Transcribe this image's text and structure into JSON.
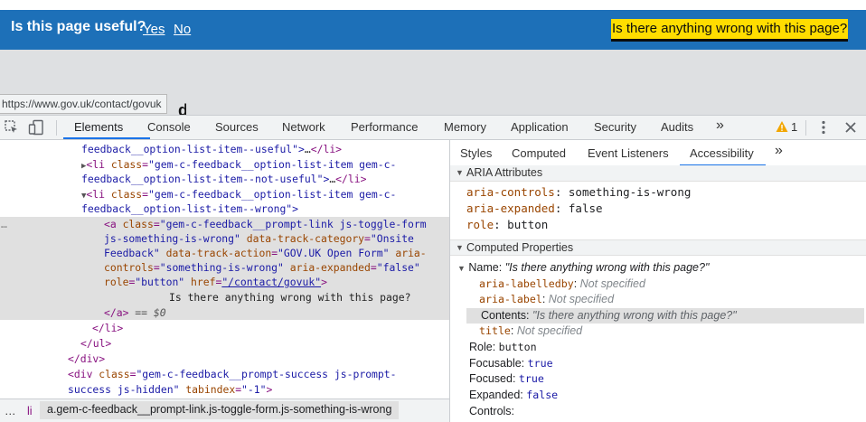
{
  "page": {
    "feedback_question": "Is this page useful?",
    "yes": "Yes",
    "no": "No",
    "wrong_link": "Is there anything wrong with this page?",
    "url_tooltip": "https://www.gov.uk/contact/govuk"
  },
  "devtools": {
    "tabs": [
      "Elements",
      "Console",
      "Sources",
      "Network",
      "Performance",
      "Memory",
      "Application",
      "Security",
      "Audits"
    ],
    "more_tabs": "»",
    "warning_count": "1",
    "code": {
      "l0_text": "feedback__option-list-item--useful\">",
      "l0_ell": "…",
      "l0_close": "</li>",
      "l1_open": "<li",
      "l1_attr": "class",
      "l1_val": "\"gem-c-feedback__option-list-item gem-c-",
      "l2_val": "feedback__option-list-item--not-useful\">",
      "l2_ell": "…",
      "l2_close": "</li>",
      "l3_open": "<li",
      "l3_attr": "class",
      "l3_val": "\"gem-c-feedback__option-list-item gem-c-",
      "l4_val": "feedback__option-list-item--wrong\">",
      "l5_dots": "…",
      "l5_open": "<a",
      "l5_attr": "class",
      "l5_val": "\"gem-c-feedback__prompt-link js-toggle-form",
      "l6_val": "js-something-is-wrong\"",
      "l6_attr": "data-track-category",
      "l6_val2": "\"Onsite",
      "l7_val": "Feedback\"",
      "l7_attr": "data-track-action",
      "l7_val2": "\"GOV.UK Open Form\"",
      "l7_attr2": "aria-",
      "l8_attr": "controls",
      "l8_val": "\"something-is-wrong\"",
      "l8_attr2": "aria-expanded",
      "l8_val2": "\"false\"",
      "l9_attr": "role",
      "l9_val": "\"button\"",
      "l9_attr2": "href",
      "l9_val2": "\"/contact/govuk\"",
      "l9_close": ">",
      "l10_text": "Is there anything wrong with this page?",
      "l11_close": "</a>",
      "l11_eq": " == ",
      "l11_var": "$0",
      "l12_close": "</li>",
      "l13_close": "</ul>",
      "l14_close": "</div>",
      "l15_open": "<div",
      "l15_attr": "class",
      "l15_val": "\"gem-c-feedback__prompt-success js-prompt-",
      "l16_val": "success js-hidden\"",
      "l16_attr": "tabindex",
      "l16_val2": "\"-1\"",
      "l16_close": ">"
    },
    "breadcrumb": {
      "ellipsis": "…",
      "li": "li",
      "current": "a.gem-c-feedback__prompt-link.js-toggle-form.js-something-is-wrong"
    },
    "sidebar": {
      "tabs": [
        "Styles",
        "Computed",
        "Event Listeners",
        "Accessibility"
      ],
      "more": "»",
      "aria_header": "ARIA Attributes",
      "aria_controls_k": "aria-controls",
      "aria_controls_v": "something-is-wrong",
      "aria_expanded_k": "aria-expanded",
      "aria_expanded_v": "false",
      "role_k": "role",
      "role_v": "button",
      "computed_header": "Computed Properties",
      "name_label": "Name:",
      "name_value": "\"Is there anything wrong with this page?\"",
      "labelledby_k": "aria-labelledby",
      "labelledby_v": "Not specified",
      "label_k": "aria-label",
      "label_v": "Not specified",
      "contents_k": "Contents:",
      "contents_v": "\"Is there anything wrong with this page?\"",
      "title_k": "title",
      "title_v": "Not specified",
      "role_label": "Role:",
      "role_value": "button",
      "focusable_label": "Focusable:",
      "focusable_value": "true",
      "focused_label": "Focused:",
      "focused_value": "true",
      "expanded_label": "Expanded:",
      "expanded_value": "false",
      "controls_label": "Controls:"
    }
  }
}
